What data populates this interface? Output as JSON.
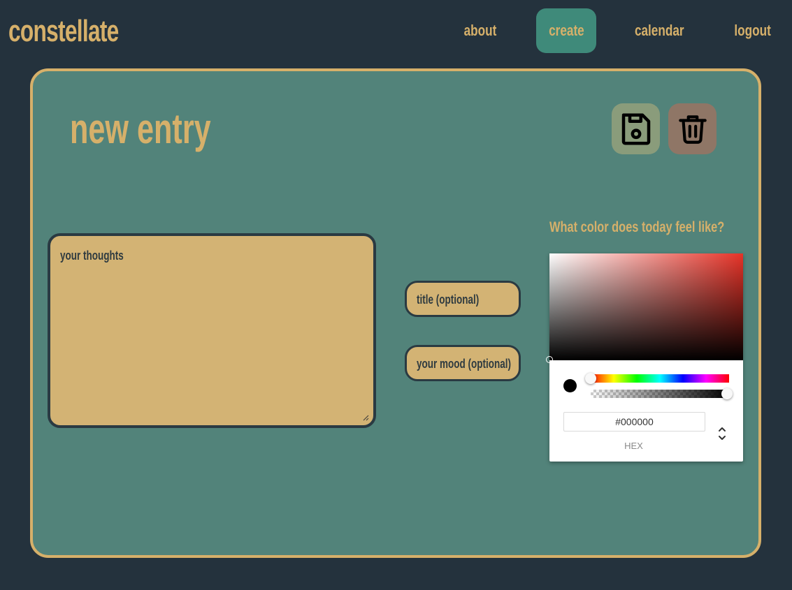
{
  "header": {
    "logo": "constellate",
    "nav": [
      {
        "label": "about",
        "active": false
      },
      {
        "label": "create",
        "active": true
      },
      {
        "label": "calendar",
        "active": false
      },
      {
        "label": "logout",
        "active": false
      }
    ]
  },
  "entry": {
    "title": "new entry",
    "save_icon": "floppy-disk-icon",
    "delete_icon": "trash-icon",
    "thoughts_placeholder": "your thoughts",
    "title_placeholder": "title (optional)",
    "mood_placeholder": "your mood (optional)"
  },
  "color_picker": {
    "question": "What color does today feel like?",
    "hex_value": "#000000",
    "format_label": "HEX",
    "hue_color": "#e63328",
    "hue_level": 0,
    "alpha_level": 1
  },
  "colors": {
    "background": "#24323d",
    "card": "#52837a",
    "accent": "#d6b06a",
    "input": "#d3b374",
    "active_nav": "#3f8a7a",
    "save_button": "#8a9c7b",
    "delete_button": "#8f7666"
  }
}
